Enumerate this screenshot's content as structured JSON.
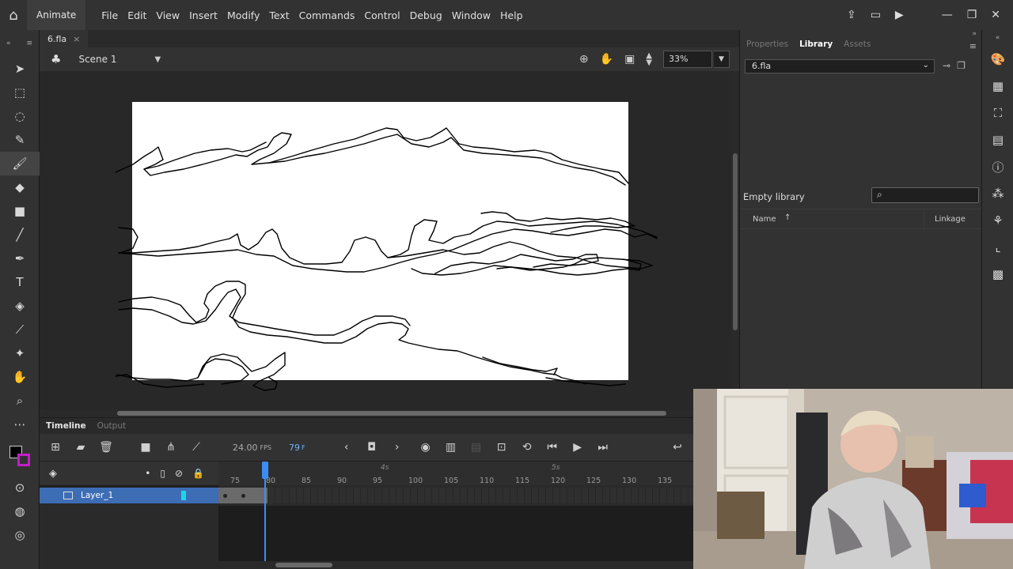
{
  "app": {
    "name": "Animate",
    "menu": [
      "File",
      "Edit",
      "View",
      "Insert",
      "Modify",
      "Text",
      "Commands",
      "Control",
      "Debug",
      "Window",
      "Help"
    ]
  },
  "document": {
    "tab_name": "6.fla",
    "scene_name": "Scene 1",
    "zoom": "33%"
  },
  "timeline": {
    "tabs": [
      "Timeline",
      "Output"
    ],
    "fps_value": "24.00",
    "fps_label": "FPS",
    "frame_value": "79",
    "frame_label": "F",
    "layer_name": "Layer_1",
    "ruler_ticks": [
      "75",
      "80",
      "85",
      "90",
      "95",
      "100",
      "105",
      "110",
      "115",
      "120",
      "125",
      "130",
      "135"
    ],
    "ruler_seconds": [
      "4s",
      "5s"
    ],
    "current_frame": 79
  },
  "library": {
    "tabs": [
      "Properties",
      "Library",
      "Assets"
    ],
    "selected_doc": "6.fla",
    "empty_text": "Empty library",
    "col_name": "Name",
    "col_linkage": "Linkage"
  },
  "colors": {
    "accent": "#3b8df5",
    "layer_highlight": "#3d6db5",
    "layer_swatch": "#18d8e8",
    "stroke_color_swatch": "#000000",
    "fill_color_swatch": "#c21ec8"
  }
}
